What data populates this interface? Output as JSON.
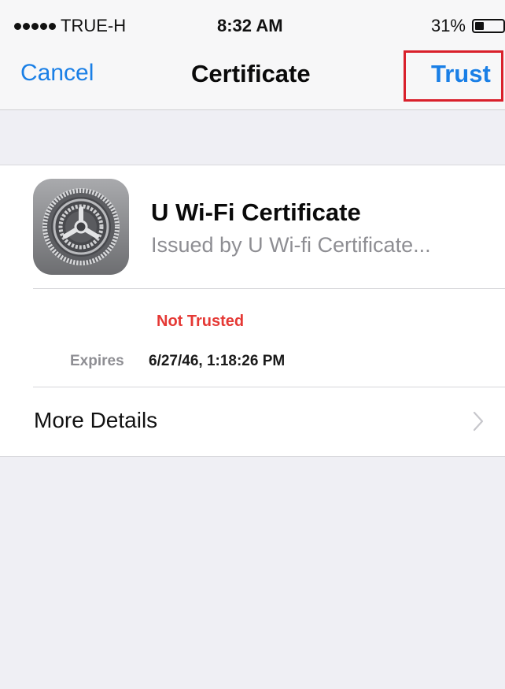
{
  "status_bar": {
    "carrier": "TRUE-H",
    "time": "8:32 AM",
    "battery_percent": "31%",
    "battery_level": 0.31
  },
  "nav": {
    "cancel_label": "Cancel",
    "title": "Certificate",
    "trust_label": "Trust",
    "highlight_color": "#d9202b"
  },
  "certificate": {
    "name": "U Wi-Fi Certificate",
    "issuer": "Issued by U Wi-fi Certificate...",
    "status": "Not Trusted",
    "expires_label": "Expires",
    "expires_value": "6/27/46, 1:18:26 PM",
    "icon": "settings-gear-icon"
  },
  "more_details": {
    "label": "More Details",
    "icon": "chevron-right-icon"
  },
  "colors": {
    "accent": "#1a7fe6",
    "status_red": "#e53935"
  }
}
